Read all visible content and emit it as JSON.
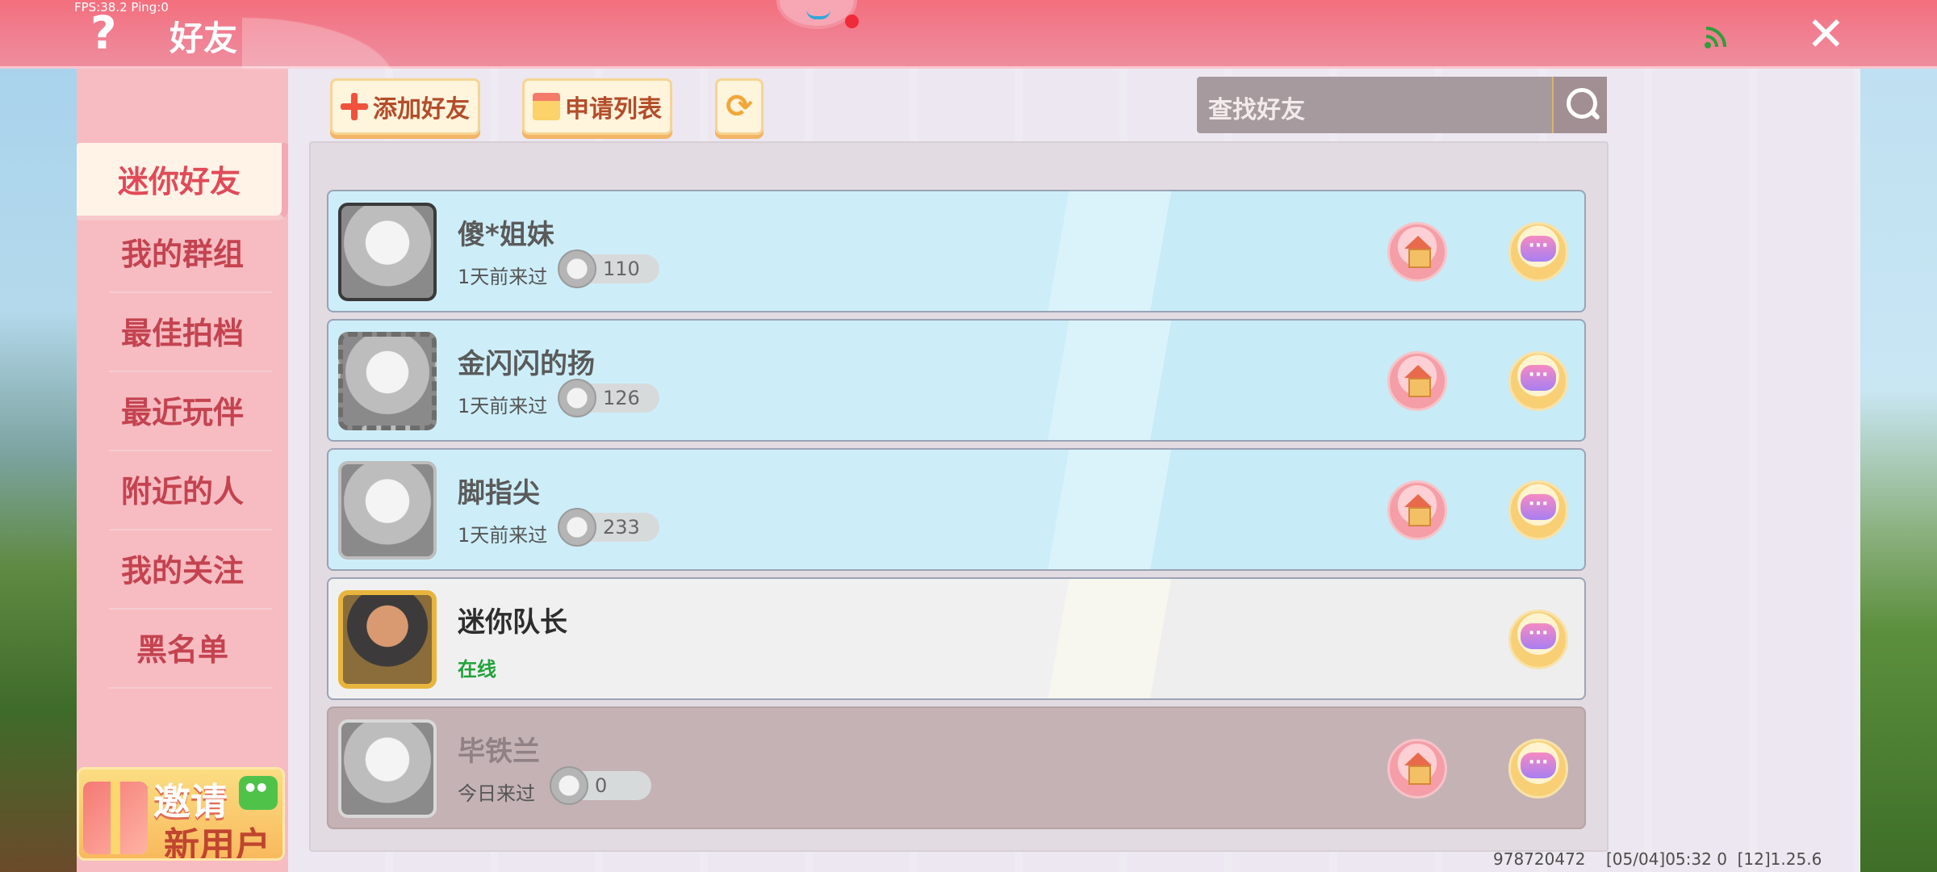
{
  "topbar": {
    "fps_text": "FPS:38.2  Ping:0",
    "help_icon": "?",
    "title": "好友",
    "close_icon": "✕"
  },
  "sidebar": {
    "items": [
      {
        "label": "迷你好友",
        "active": true
      },
      {
        "label": "我的群组"
      },
      {
        "label": "最佳拍档"
      },
      {
        "label": "最近玩伴"
      },
      {
        "label": "附近的人"
      },
      {
        "label": "我的关注"
      },
      {
        "label": "黑名单"
      }
    ],
    "invite": {
      "line1": "邀请",
      "line2": "新用户"
    }
  },
  "toolbar": {
    "add_friend_label": "添加好友",
    "request_list_label": "申请列表",
    "refresh_icon": "⟳",
    "search_placeholder": "查找好友"
  },
  "friends": [
    {
      "name": "傻*姐妹",
      "status": "1天前来过",
      "level": "110",
      "has_home": true
    },
    {
      "name": "金闪闪的扬",
      "status": "1天前来过",
      "level": "126",
      "has_home": true
    },
    {
      "name": "脚指尖",
      "status": "1天前来过",
      "level": "233",
      "has_home": true
    },
    {
      "name": "迷你队长",
      "status": "在线",
      "online": true,
      "has_home": false
    },
    {
      "name": "毕铁兰",
      "status": "今日来过",
      "level": "0",
      "has_home": true
    }
  ],
  "footer": {
    "info": "978720472    [05/04]05:32 0  [12]1.25.6"
  },
  "colors": {
    "topbar": "#f36f7d",
    "sidebar": "#f7bcc2",
    "online_green": "#21a33a",
    "card_blue": "#cdeef9"
  }
}
